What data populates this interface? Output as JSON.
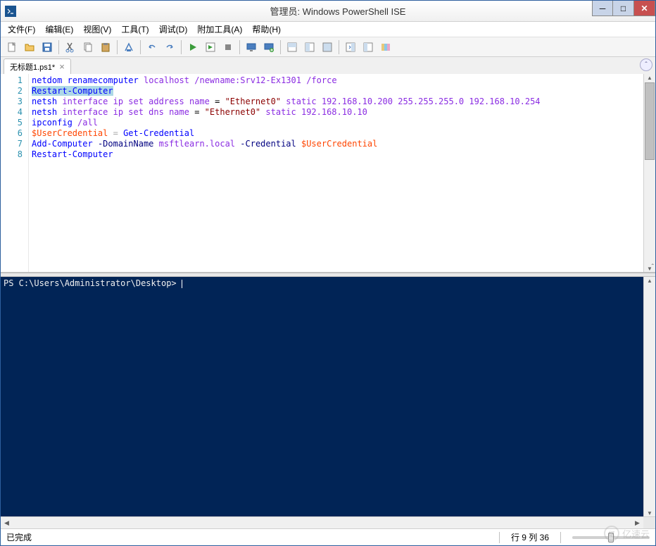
{
  "window": {
    "title": "管理员: Windows PowerShell ISE"
  },
  "menu": {
    "file": "文件(F)",
    "edit": "编辑(E)",
    "view": "视图(V)",
    "tools": "工具(T)",
    "debug": "调试(D)",
    "addons": "附加工具(A)",
    "help": "帮助(H)"
  },
  "tab": {
    "label": "无标题1.ps1*"
  },
  "code": {
    "lines": [
      {
        "n": "1",
        "tokens": [
          {
            "t": "netdom",
            "c": "tok-cmd"
          },
          {
            "t": " "
          },
          {
            "t": "renamecomputer",
            "c": "tok-cmd"
          },
          {
            "t": " "
          },
          {
            "t": "localhost",
            "c": "tok-arg"
          },
          {
            "t": " "
          },
          {
            "t": "/newname:Srv12-Ex1301",
            "c": "tok-arg"
          },
          {
            "t": " "
          },
          {
            "t": "/force",
            "c": "tok-arg"
          }
        ]
      },
      {
        "n": "2",
        "tokens": [
          {
            "t": "Restart-Computer",
            "c": "tok-cmd sel"
          }
        ]
      },
      {
        "n": "3",
        "tokens": [
          {
            "t": "netsh",
            "c": "tok-cmd"
          },
          {
            "t": " "
          },
          {
            "t": "interface ip set address name",
            "c": "tok-arg"
          },
          {
            "t": " = "
          },
          {
            "t": "\"Ethernet0\"",
            "c": "tok-str"
          },
          {
            "t": " "
          },
          {
            "t": "static 192.168.10.200 255.255.255.0 192.168.10.254",
            "c": "tok-arg"
          }
        ]
      },
      {
        "n": "4",
        "tokens": [
          {
            "t": "netsh",
            "c": "tok-cmd"
          },
          {
            "t": " "
          },
          {
            "t": "interface ip set dns name",
            "c": "tok-arg"
          },
          {
            "t": " = "
          },
          {
            "t": "\"Ethernet0\"",
            "c": "tok-str"
          },
          {
            "t": " "
          },
          {
            "t": "static 192.168.10.10",
            "c": "tok-arg"
          }
        ]
      },
      {
        "n": "5",
        "tokens": [
          {
            "t": "ipconfig",
            "c": "tok-cmd"
          },
          {
            "t": " "
          },
          {
            "t": "/all",
            "c": "tok-arg"
          }
        ]
      },
      {
        "n": "6",
        "tokens": [
          {
            "t": "$UserCredential",
            "c": "tok-var"
          },
          {
            "t": " "
          },
          {
            "t": "=",
            "c": "tok-op"
          },
          {
            "t": " "
          },
          {
            "t": "Get-Credential",
            "c": "tok-cmd"
          }
        ]
      },
      {
        "n": "7",
        "tokens": [
          {
            "t": "Add-Computer",
            "c": "tok-cmd"
          },
          {
            "t": " "
          },
          {
            "t": "-DomainName",
            "c": "tok-param"
          },
          {
            "t": " "
          },
          {
            "t": "msftlearn.local",
            "c": "tok-arg"
          },
          {
            "t": " "
          },
          {
            "t": "-Credential",
            "c": "tok-param"
          },
          {
            "t": " "
          },
          {
            "t": "$UserCredential",
            "c": "tok-var"
          }
        ]
      },
      {
        "n": "8",
        "tokens": [
          {
            "t": "Restart-Computer",
            "c": "tok-cmd"
          }
        ]
      }
    ]
  },
  "console": {
    "prompt": "PS C:\\Users\\Administrator\\Desktop> "
  },
  "status": {
    "left": "已完成",
    "pos": "行 9 列 36"
  },
  "watermark": "亿速云",
  "icons": {
    "new": "new-file-icon",
    "open": "open-folder-icon",
    "save": "save-icon",
    "cut": "cut-icon",
    "copy": "copy-icon",
    "paste": "paste-icon",
    "clear": "clear-icon",
    "undo": "undo-icon",
    "redo": "redo-icon",
    "run": "run-icon",
    "runsel": "run-selection-icon",
    "stop": "stop-icon",
    "remote": "remote-icon",
    "newremote": "new-remote-icon",
    "layout1": "layout-script-icon",
    "layout2": "layout-side-icon",
    "layout3": "layout-max-icon",
    "cmdpane": "command-pane-icon",
    "cmdaddon": "command-addon-icon",
    "options": "options-icon"
  }
}
